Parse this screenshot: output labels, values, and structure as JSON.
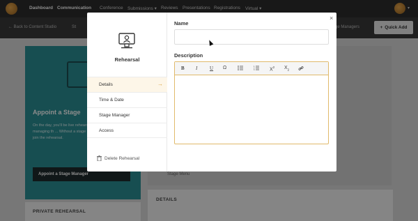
{
  "nav": {
    "items": [
      "Dashboard",
      "Communication",
      "Conference",
      "Submissions ▾",
      "Reviews",
      "Presentations",
      "Registrations",
      "Virtual ▾"
    ],
    "active": "Communication"
  },
  "subbar": {
    "back_label": "← Back to Content Studio",
    "middle_label": "St",
    "right_label": "ge Managers",
    "quick_add_label": "Quick Add",
    "quick_add_icon": "plus-icon"
  },
  "background": {
    "teal_title": "Appoint a Stage",
    "teal_text": "On the day, you'll be live rehearsal and managing th ... Without a stage manager y can't join the rehearsal.",
    "teal_button": "Appoint a Stage Manager",
    "private_label": "PRIVATE REHEARSAL",
    "details_label": "DETAILS",
    "stage_tag": "Stage Menu"
  },
  "modal": {
    "title": "Rehearsal",
    "close_label": "×",
    "menu": [
      {
        "label": "Details",
        "active": true
      },
      {
        "label": "Time & Date",
        "active": false
      },
      {
        "label": "Stage Manager",
        "active": false
      },
      {
        "label": "Access",
        "active": false
      }
    ],
    "delete_label": "Delete Rehearsal",
    "name_label": "Name",
    "name_value": "",
    "description_label": "Description",
    "description_value": "",
    "toolbar": [
      "B",
      "I",
      "U",
      "Ω",
      "bullet-list",
      "numbered-list",
      "superscript",
      "subscript",
      "link"
    ]
  },
  "colors": {
    "accent": "#d9a13e",
    "teal": "#2b8f94",
    "nav_bg": "#2d2d2d"
  }
}
